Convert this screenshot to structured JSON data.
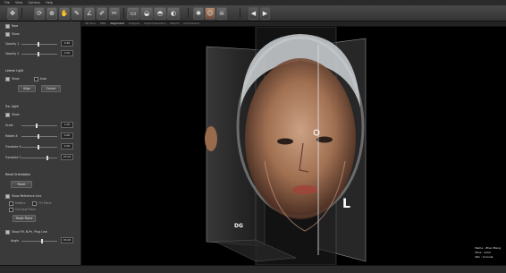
{
  "menu": [
    "File",
    "View",
    "Options",
    "Help"
  ],
  "toolbar": {
    "buttons": [
      "move-icon",
      "rotate-icon",
      "zoom-icon",
      "pan-icon",
      "measure-icon",
      "angle-icon",
      "annotate-icon",
      "cut-icon"
    ],
    "view_buttons": [
      "axial-view-icon",
      "coronal-view-icon",
      "sagittal-view-icon",
      "volume-view-icon"
    ],
    "render_buttons": [
      "settings-icon",
      "face-photo-icon",
      "skull-icon"
    ],
    "nav": [
      "◀",
      "▶"
    ]
  },
  "view_tabs": [
    "3D Face",
    "MPR",
    "Alignment",
    "Analysis",
    "Superimposition",
    "Report",
    "Comparison"
  ],
  "active_tab_index": 2,
  "panel": {
    "section1_header": "Face",
    "show_label": "Show",
    "opacity1_label": "Opacity 1",
    "opacity1_value": "0.50",
    "opacity2_label": "Opacity 2",
    "opacity2_value": "0.00",
    "light_header": "Lateral Light",
    "light_on_label": "Show",
    "light_auto_label": "Auto",
    "align_button": "Align",
    "cancel_button": "Cancel",
    "tra_header": "Tra. Light",
    "tra_show_label": "Show",
    "scale_label": "Scale",
    "scale_value": "1.00",
    "rotate_label": "Rotate X",
    "rotate_value": "0.00",
    "translate_label": "Translate X",
    "translate_value": "0.00",
    "translate2_label": "Translate Y",
    "translate2_value": "25.00",
    "reset_header": "Reset Orientation",
    "reset_button": "Reset",
    "ref_label": "Show Reference Line",
    "ref_opt1": "Midline",
    "ref_opt2": "FH Plane",
    "ref_opt3": "Occlusal Plane",
    "ref_button": "Reset Plane",
    "plane_label": "Show FH, N-Pn, Plag Line",
    "angle_label": "Angle",
    "angle_value": "45.00"
  },
  "viewport": {
    "label_left": "DG",
    "label_right": "L",
    "info_lines": [
      "Name : Zhen Meng",
      "Slice : Axial",
      "Win : Coronal"
    ]
  },
  "status": ""
}
